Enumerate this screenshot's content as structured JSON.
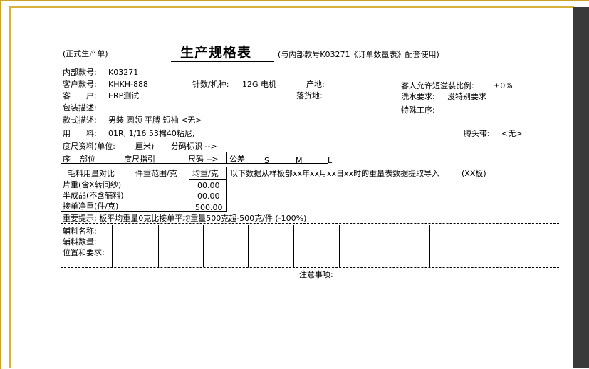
{
  "header": {
    "formal_tag": "(正式生产单)",
    "title": "生产规格表",
    "subtitle": "(与内部款号K03271《订单数量表》配套使用)"
  },
  "info": {
    "internal_no_label": "内部款号:",
    "internal_no": "K03271",
    "customer_no_label": "客户款号:",
    "customer_no": "KHKH-888",
    "customer_label": "客　　户:",
    "customer": "ERP测试",
    "packing_label": "包装描述:",
    "style_desc_label": "款式描述:",
    "style_desc": "男装 圆领 平膊 短袖 <无>",
    "material_label": "用　　料:",
    "material": "01R, 1/16 53棉40粘尼,",
    "needle_label": "针数/机种:",
    "needle": "12G 电机",
    "origin_label": "产地:",
    "delivery_label": "落货地:",
    "tolerance_label": "客人允许短溢装比例:",
    "tolerance": "±0%",
    "wash_label": "洗水要求:",
    "wash": "没特别要求",
    "special_label": "特殊工序:",
    "waist_label": "膊头带:",
    "waist": "<无>"
  },
  "size_section": {
    "size_data_label": "度尺资料(单位:",
    "unit": "厘米)",
    "code_label": "分码标识 -->",
    "col_seq": "序",
    "col_part": "部位",
    "col_method": "度尺指引",
    "col_size": "尺码 -->",
    "col_tolerance": "公差",
    "sizes": [
      "S",
      "M",
      "L"
    ]
  },
  "weight_section": {
    "col1_header": "毛料用量对比",
    "col2_header": "件重范围/克",
    "col3_header": "均重/克",
    "note": "以下数据从样板部xx年xx月xx日xx时的重量表数据提取导入",
    "note_tag": "(XX板)",
    "rows": [
      {
        "label": "片重(含X转间纱)",
        "value": "00.00"
      },
      {
        "label": "半成品(不含辅料)",
        "value": "00.00"
      },
      {
        "label": "接单净重(件/克)",
        "value": "500.00"
      }
    ]
  },
  "warning": "重要提示: 板平均重量0克比接单平均重量500克超-500克/件 (-100%)",
  "accessories": {
    "name_label": "辅料名称:",
    "qty_label": "辅料数量:",
    "pos_label": "位置和要求:"
  },
  "notes_label": "注意事项:"
}
